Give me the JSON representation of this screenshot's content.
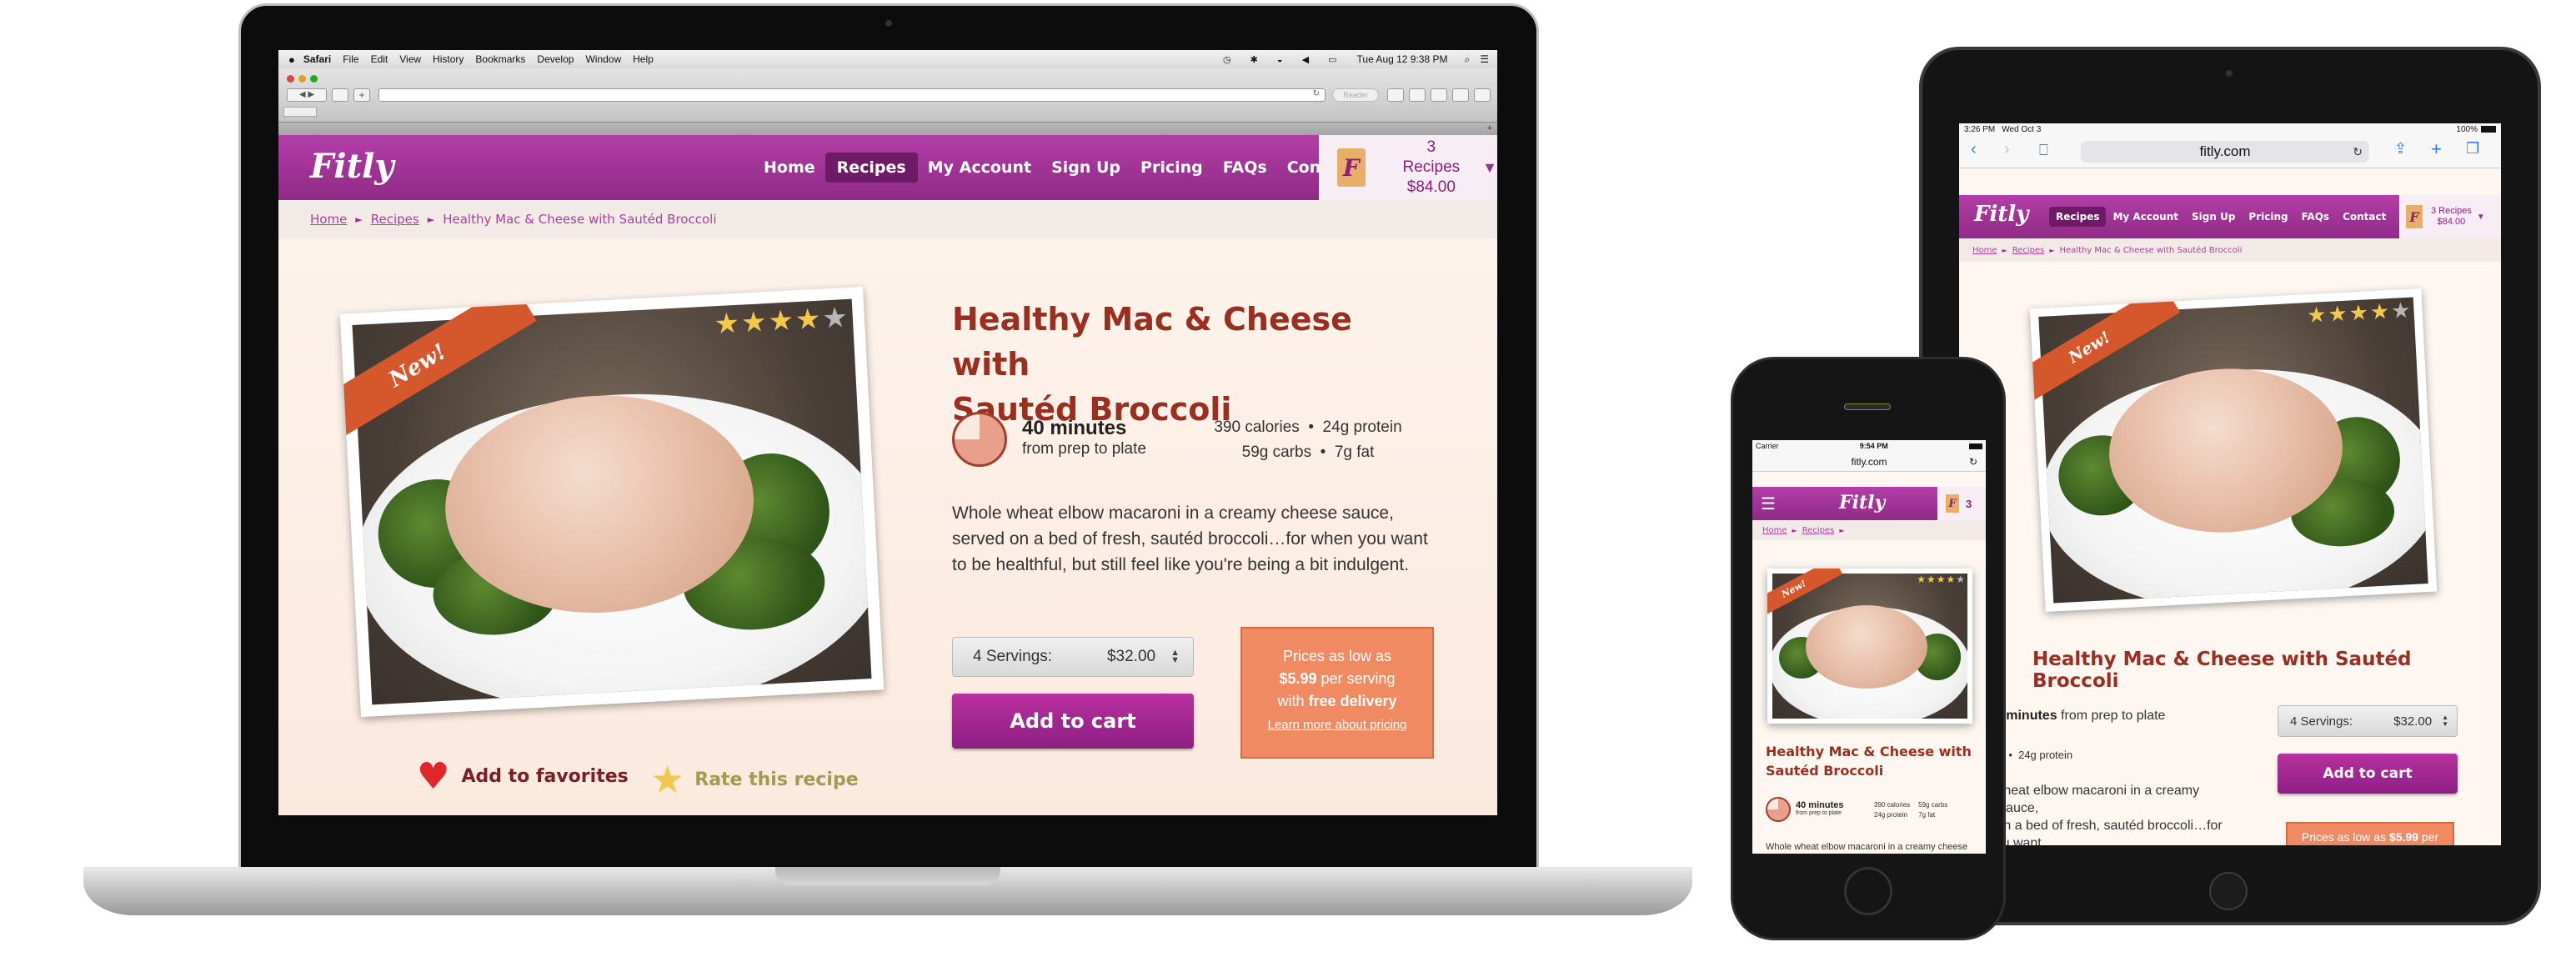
{
  "site": {
    "logo": "Fitly",
    "nav": [
      "Home",
      "Recipes",
      "My Account",
      "Sign Up",
      "Pricing",
      "FAQs",
      "Contact"
    ],
    "cart": {
      "recipes": "3 Recipes",
      "total": "$84.00",
      "bag_letter": "F",
      "phone_count": "3"
    },
    "breadcrumb": {
      "home": "Home",
      "recipes": "Recipes",
      "current": "Healthy Mac & Cheese with Sautéd Broccoli",
      "sep": "►"
    },
    "recipe": {
      "badge": "New!",
      "stars": "★★★★",
      "stars_off": "★",
      "rating": 4,
      "title": "Healthy Mac & Cheese with Sautéd Broccoli",
      "title_line1": "Healthy Mac & Cheese with",
      "title_line2": "Sautéd Broccoli",
      "time": "40 minutes",
      "time_sub": "from prep to plate",
      "nutrition_line1": "390 calories  •  24g protein",
      "nutrition_line2": "59g carbs  •  7g fat",
      "nutrition_calories": "390 calories",
      "nutrition_protein": "24g protein",
      "nutrition_carbs": "59g carbs",
      "nutrition_fat": "7g fat",
      "desc_line1": "Whole wheat elbow macaroni in a creamy cheese sauce,",
      "desc_line2": "served on a bed of fresh, sautéd broccoli…for when you want",
      "desc_line3": "to be healthful, but still feel like you're being a bit indulgent.",
      "servings_label": "4 Servings:",
      "servings_price": "$32.00",
      "add_to_cart": "Add to cart",
      "promo_line1": "Prices as low as",
      "promo_price": "$5.99",
      "promo_line2b": " per serving",
      "promo_line3a": "with ",
      "promo_line3b": "free delivery",
      "promo_link": "Learn more about pricing",
      "favorites": "Add to favorites",
      "rate": "Rate this recipe"
    }
  },
  "mac": {
    "menu": [
      "Safari",
      "File",
      "Edit",
      "View",
      "History",
      "Bookmarks",
      "Develop",
      "Window",
      "Help"
    ],
    "clock": "Tue Aug 12  9:38 PM",
    "reader": "Reader"
  },
  "ipad": {
    "time": "3:26 PM",
    "date": "Wed Oct 3",
    "battery": "100%",
    "url": "fitly.com"
  },
  "iphone": {
    "carrier": "Carrier",
    "time": "9:54 PM",
    "url": "fitly.com"
  },
  "colors": {
    "brand": "#9b2f90",
    "title": "#9a2e1f",
    "promo": "#ef8a62",
    "cream": "#fdf6f1"
  }
}
